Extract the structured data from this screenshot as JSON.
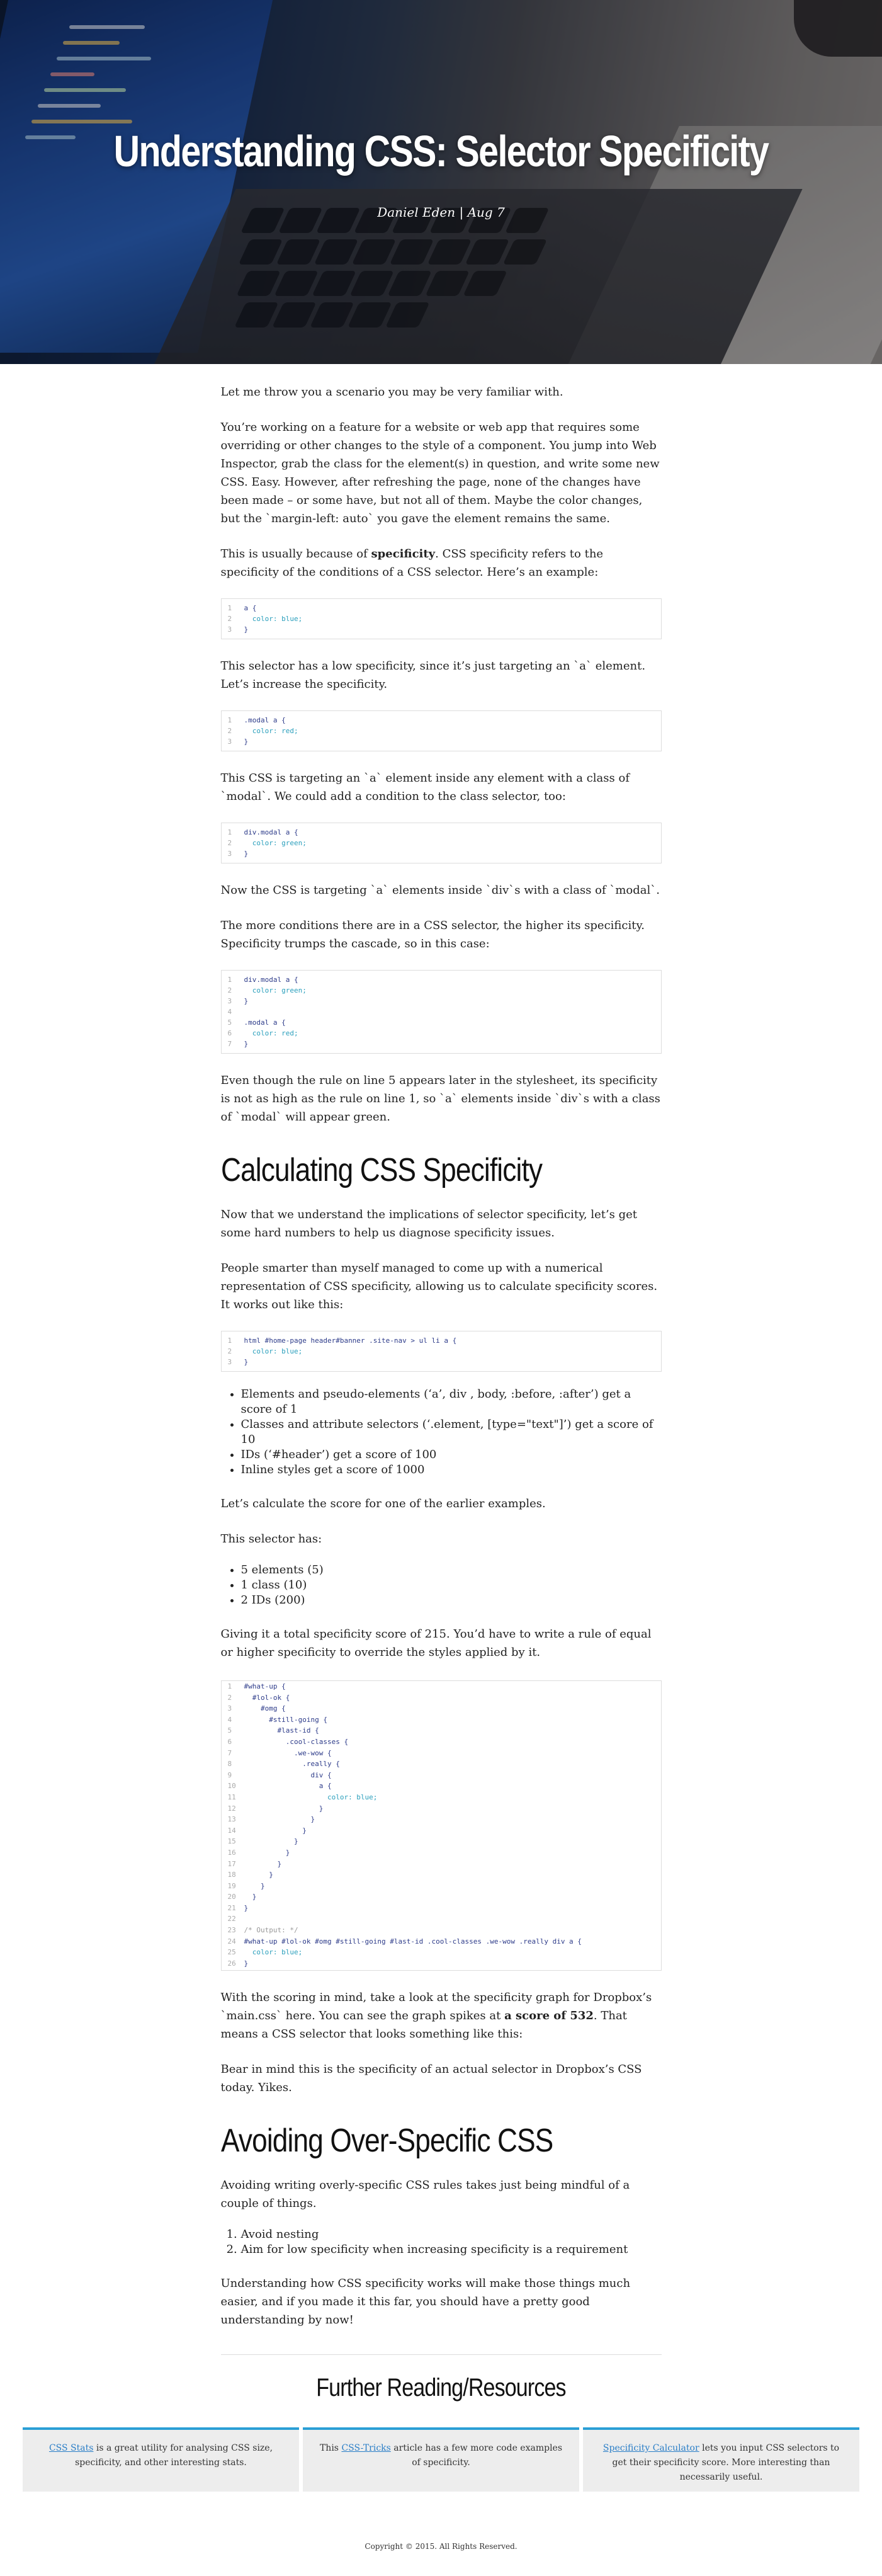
{
  "hero": {
    "title": "Understanding CSS: Selector Specificity",
    "meta": "Daniel Eden | Aug 7"
  },
  "article": {
    "intro": "Let me throw you a scenario you may be very familiar with.",
    "p_working": "You’re working on a feature for a website or web app that requires some overriding or other changes to the style of a component. You jump into Web Inspector, grab the class for the element(s) in question, and write some new CSS. Easy. However, after refreshing the page, none of the changes have been made – or some have, but not all of them. Maybe the color changes, but the `margin-left: auto` you gave the element remains the same.",
    "p_usually_a": "This is usually because of ",
    "p_usually_bold": "specificity",
    "p_usually_b": ". CSS specificity refers to the specificity of the conditions of a CSS selector. Here’s an example:",
    "p_low": "This selector has a low specificity, since it’s just targeting an `a` element. Let’s increase the specificity.",
    "p_modal": "This CSS is targeting an `a` element inside any element with a class of `modal`. We could add a condition to the class selector, too:",
    "p_now": "Now the CSS is targeting `a` elements inside `div`s with a class of `modal`.",
    "p_more": "The more conditions there are in a CSS selector, the higher its specificity. Specificity trumps the cascade, so in this case:",
    "p_even": "Even though the rule on line 5 appears later in the stylesheet, its specificity is not as high as the rule on line 1, so `a` elements inside `div`s with a class of `modal` will appear green.",
    "h_calc": "Calculating CSS Specificity",
    "p_now_that": "Now that we understand the implications of selector specificity, let’s get some hard numbers to help us diagnose specificity issues.",
    "p_smarter": "People smarter than myself managed to come up with a numerical representation of CSS specificity, allowing us to calculate specificity scores. It works out like this:",
    "score_list": [
      "Elements and pseudo-elements (‘a’, div , body, :before, :after’) get a score of 1",
      "Classes and attribute selectors (‘.element, [type=\"text\"]’) get a score of 10",
      "IDs (‘#header’) get a score of 100",
      "Inline styles get a score of 1000"
    ],
    "p_lets": "Let’s calculate the score for one of the earlier examples.",
    "p_has": "This selector has:",
    "has_list": [
      "5 elements (5)",
      "1 class (10)",
      "2 IDs (200)"
    ],
    "p_giving": "Giving it a total specificity score of 215. You’d have to write a rule of equal or higher specificity to override the styles applied by it.",
    "p_with_a": "With the scoring in mind, take a look at the specificity graph for Dropbox’s `main.css` here. You can see the graph spikes at ",
    "p_with_bold": "a score of 532",
    "p_with_b": ". That means a CSS selector that looks something like this:",
    "p_bear": "Bear in mind this is the specificity of an actual selector in Dropbox’s CSS today. Yikes.",
    "h_avoid": "Avoiding Over-Specific CSS",
    "p_avoiding": "Avoiding writing overly-specific CSS rules takes just being mindful of a couple of things.",
    "avoid_list": [
      "Avoid nesting",
      "Aim for low specificity when increasing specificity is a requirement"
    ],
    "p_understanding": "Understanding how CSS specificity works will make those things much easier, and if you made it this far, you should have a pretty good understanding by now!"
  },
  "code_blocks": {
    "c1": [
      "a {",
      "  color: blue;",
      "}"
    ],
    "c2": [
      ".modal a {",
      "  color: red;",
      "}"
    ],
    "c3": [
      "div.modal a {",
      "  color: green;",
      "}"
    ],
    "c4": [
      "div.modal a {",
      "  color: green;",
      "}",
      "",
      ".modal a {",
      "  color: red;",
      "}"
    ],
    "c5": [
      "html #home-page header#banner .site-nav > ul li a {",
      "  color: blue;",
      "}"
    ],
    "c6": [
      "#what-up {",
      "  #lol-ok {",
      "    #omg {",
      "      #still-going {",
      "        #last-id {",
      "          .cool-classes {",
      "            .we-wow {",
      "              .really {",
      "                div {",
      "                  a {",
      "                    color: blue;",
      "                  }",
      "                }",
      "              }",
      "            }",
      "          }",
      "        }",
      "      }",
      "    }",
      "  }",
      "}",
      "",
      "/* Output: */",
      "#what-up #lol-ok #omg #still-going #last-id .cool-classes .we-wow .really div a {",
      "  color: blue;",
      "}"
    ]
  },
  "further": {
    "title": "Further Reading/Resources",
    "cards": [
      {
        "link": "CSS Stats",
        "text": " is a great utility for analysing CSS size, specificity, and other interesting stats.",
        "prefix": ""
      },
      {
        "prefix": "This ",
        "link": "CSS-Tricks",
        "text": " article has a few more code examples of specificity."
      },
      {
        "prefix": "",
        "link": "Specificity Calculator",
        "text": " lets you input CSS selectors to get their specificity score. More interesting than necessarily useful."
      }
    ]
  },
  "footer": {
    "text": "Copyright © 2015. All Rights Reserved."
  },
  "colors": {
    "accent": "#2a9fd6",
    "link": "#2a7ec7",
    "code_selector": "#2e3c8a",
    "code_property": "#2a9fbc"
  }
}
